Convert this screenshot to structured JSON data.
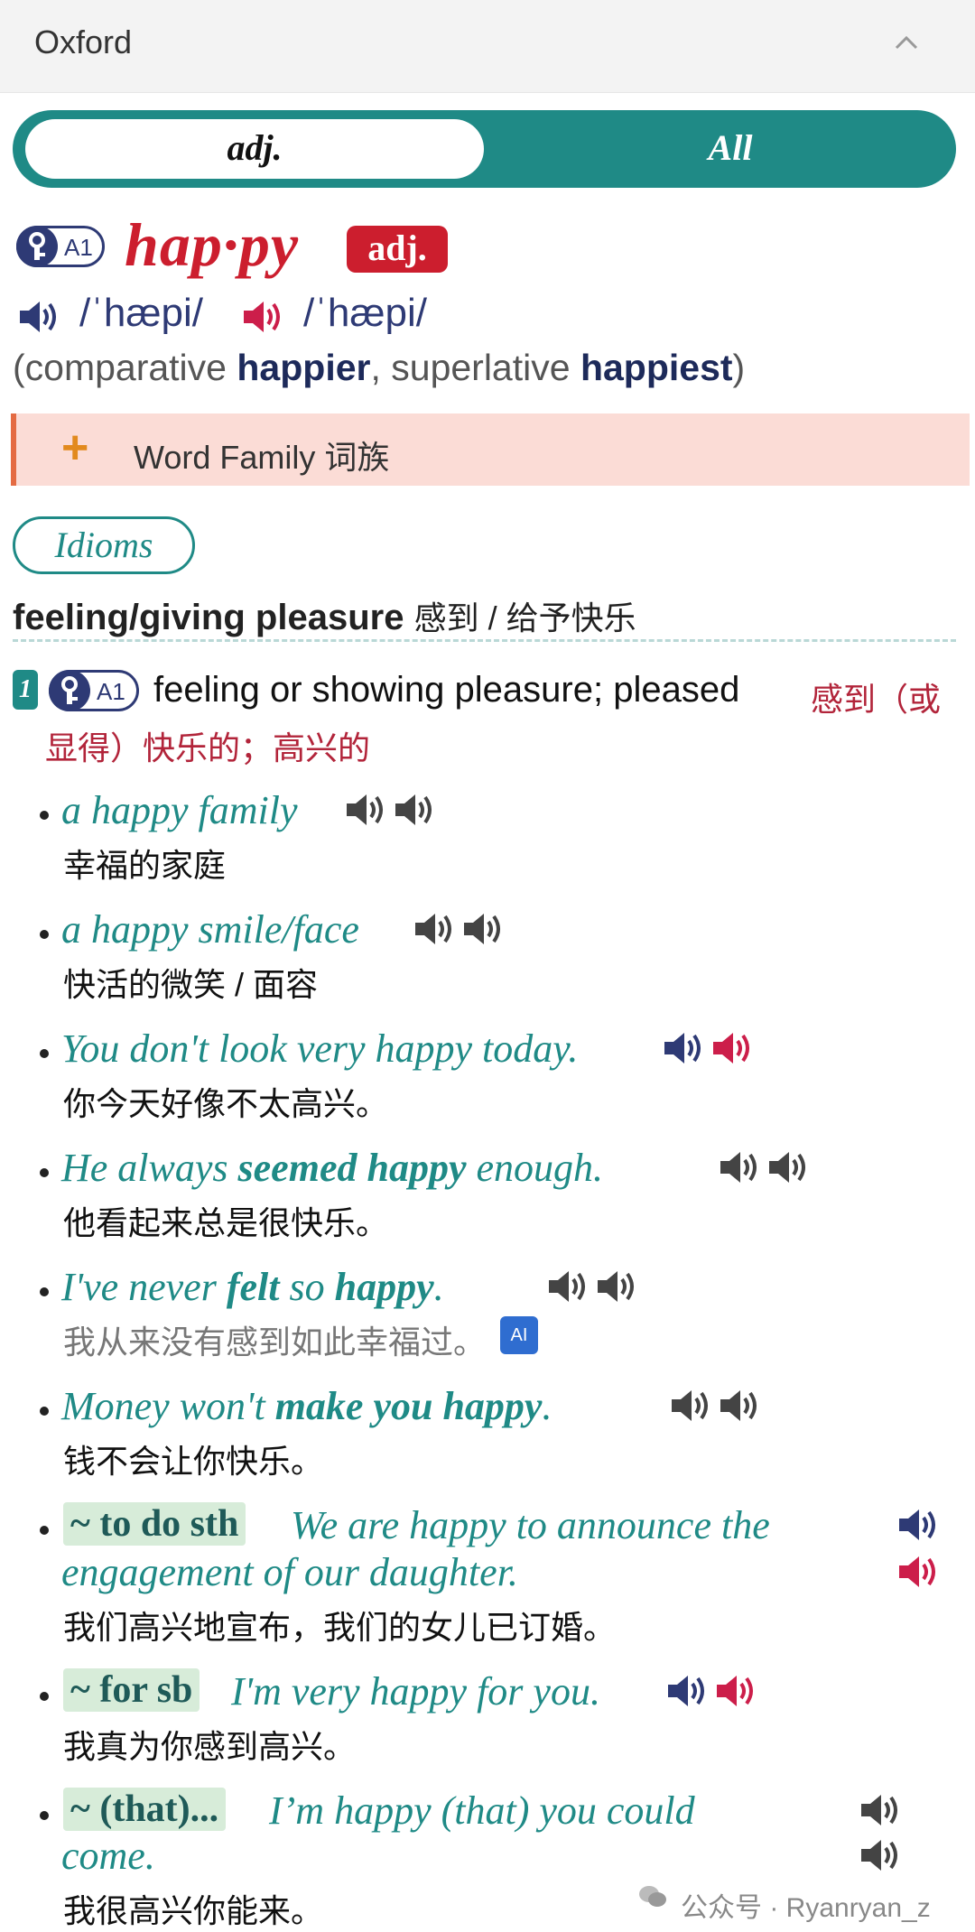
{
  "header": {
    "title": "Oxford"
  },
  "pos_toggle": {
    "active": "adj.",
    "other": "All"
  },
  "entry": {
    "level": "A1",
    "headword": "hap·py",
    "pos": "adj.",
    "pron_uk": "/ˈhæpi/",
    "pron_us": "/ˈhæpi/",
    "inflect_prefix": "(comparative",
    "comparative": "happier",
    "inflect_mid": ", superlative",
    "superlative": "happiest",
    "inflect_suffix": ")",
    "word_family_label": "Word Family 词族",
    "idioms_label": "Idioms",
    "shortcut_en": "feeling/giving pleasure",
    "shortcut_zh": "感到 / 给予快乐",
    "sense_num": "1",
    "definition": "feeling or showing pleasure; pleased",
    "definition_zh_1": "感到（或",
    "definition_zh_2": "显得）快乐的；高兴的"
  },
  "examples": [
    {
      "text": "a happy family",
      "zh": "幸福的家庭"
    },
    {
      "text": "a happy smile/face",
      "zh": "快活的微笑 / 面容"
    },
    {
      "text": "You don't look very happy today.",
      "zh": "你今天好像不太高兴。"
    },
    {
      "pre": "He always ",
      "bold": "seemed happy",
      "post": " enough.",
      "zh": "他看起来总是很快乐。"
    },
    {
      "pre": "I've never ",
      "bold1": "felt",
      "mid": " so ",
      "bold2": "happy",
      "post": ".",
      "zh": "我从来没有感到如此幸福过。",
      "ai": "AI"
    },
    {
      "pre": "Money won't ",
      "bold": "make you happy",
      "post": ".",
      "zh": "钱不会让你快乐。"
    },
    {
      "cue": "~ to do sth",
      "line1": "We are happy to announce the",
      "line2": "engagement of our daughter.",
      "zh": "我们高兴地宣布，我们的女儿已订婚。"
    },
    {
      "cue": "~ for sb",
      "text": "I'm very happy for you.",
      "zh": "我真为你感到高兴。"
    },
    {
      "cue": "~ (that)...",
      "line1": "I’m happy (that) you could",
      "line2": "come.",
      "zh": "我很高兴你能来。"
    }
  ],
  "icons": {
    "uk_color": "#2e3a75",
    "us_color": "#cc1e4a",
    "grey_color": "#444444"
  },
  "watermark": "公众号 · Ryanryan_z"
}
